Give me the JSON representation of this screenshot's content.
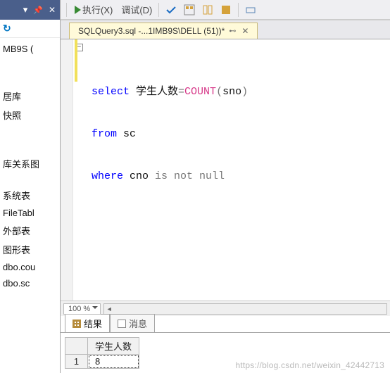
{
  "toolbar": {
    "execute_label": "执行(X)",
    "debug_label": "调试(D)"
  },
  "document_tab": {
    "title": "SQLQuery3.sql -...1IMB9S\\DELL (51))*"
  },
  "code": {
    "line1_prefix_kw": "select",
    "line1_alias": " 学生人数",
    "line1_eq": "=",
    "line1_fn": "COUNT",
    "line1_paren_open": "(",
    "line1_col": "sno",
    "line1_paren_close": ")",
    "line2_kw": "from",
    "line2_table": " sc",
    "line3_kw": "where",
    "line3_col": " cno ",
    "line3_op": "is not null"
  },
  "zoom": {
    "value": "100 %"
  },
  "results_tabs": {
    "results_label": "结果",
    "messages_label": "消息"
  },
  "grid": {
    "header": "学生人数",
    "row1_num": "1",
    "row1_val": "8"
  },
  "tree": {
    "node0": "MB9S (",
    "node1": "居库",
    "node2": "快照",
    "node3": "库关系图",
    "node4": "系统表",
    "node5": "FileTabl",
    "node6": "外部表",
    "node7": "图形表",
    "node8": "dbo.cou",
    "node9": "dbo.sc"
  },
  "watermark": "https://blog.csdn.net/weixin_42442713"
}
